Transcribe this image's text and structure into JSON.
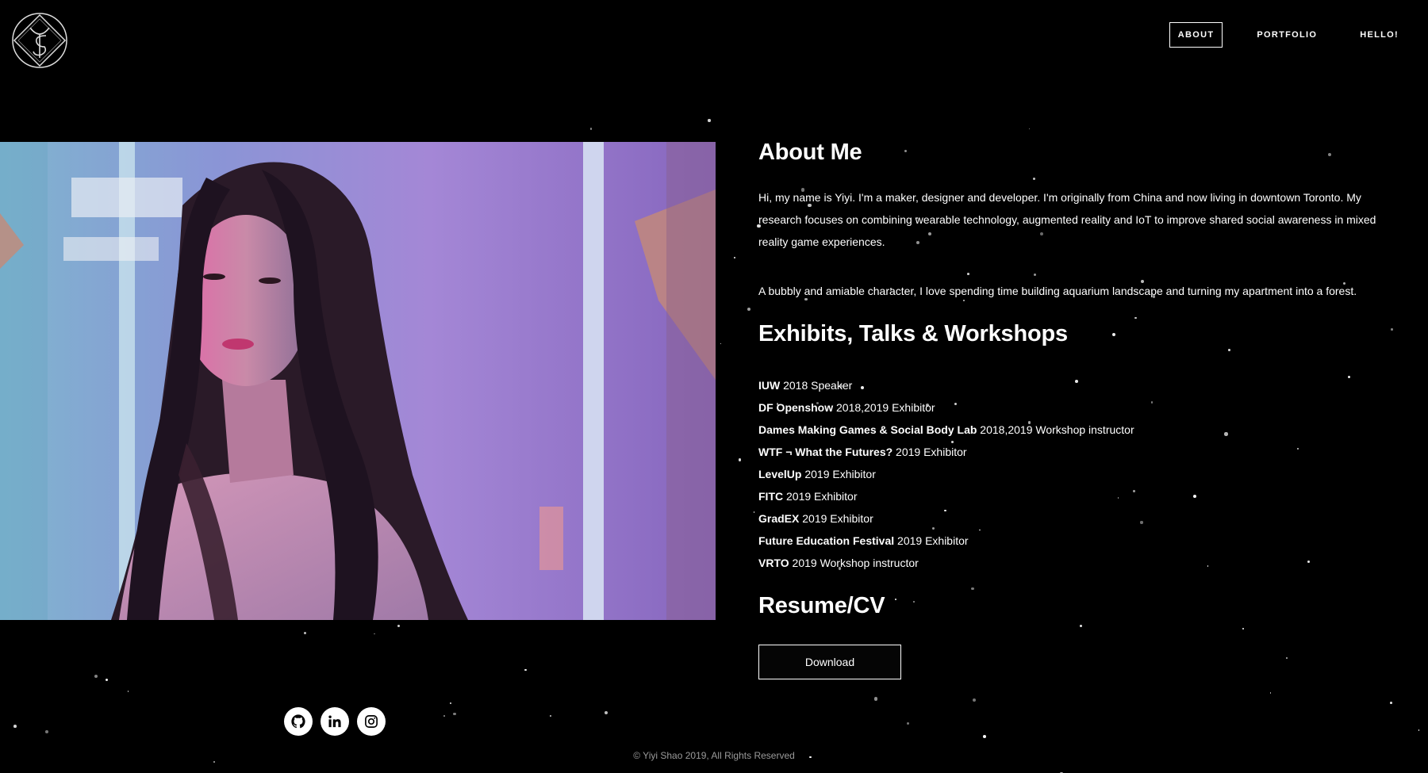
{
  "nav": {
    "items": [
      {
        "label": "ABOUT",
        "active": true
      },
      {
        "label": "PORTFOLIO",
        "active": false
      },
      {
        "label": "HELLO!",
        "active": false
      }
    ]
  },
  "about": {
    "title": "About Me",
    "paragraph1": "Hi, my name is Yiyi. I'm a maker, designer and developer. I'm originally from China and now living in downtown Toronto. My research focuses on combining wearable technology, augmented reality and IoT to improve shared social awareness in mixed reality game experiences.",
    "paragraph2": "A bubbly and amiable character, I love spending time building aquarium landscape and turning my apartment into a forest."
  },
  "exhibits": {
    "title": "Exhibits, Talks & Workshops",
    "items": [
      {
        "name": "IUW",
        "detail": " 2018 Speaker"
      },
      {
        "name": "DF Openshow",
        "detail": " 2018,2019 Exhibitor"
      },
      {
        "name": "Dames Making Games & Social Body Lab",
        "detail": " 2018,2019 Workshop instructor"
      },
      {
        "name": "WTF ¬ What the Futures?",
        "detail": " 2019 Exhibitor"
      },
      {
        "name": "LevelUp",
        "detail": " 2019 Exhibitor"
      },
      {
        "name": "FITC",
        "detail": " 2019 Exhibitor"
      },
      {
        "name": "GradEX",
        "detail": " 2019 Exhibitor"
      },
      {
        "name": "Future Education Festival",
        "detail": " 2019 Exhibitor"
      },
      {
        "name": "VRTO",
        "detail": " 2019 Workshop instructor"
      }
    ]
  },
  "resume": {
    "title": "Resume/CV",
    "download_label": "Download"
  },
  "social": [
    "github-icon",
    "linkedin-icon",
    "instagram-icon"
  ],
  "footer": {
    "copyright": "© Yiyi Shao 2019, All Rights Reserved"
  },
  "colors": {
    "background": "#000000",
    "text": "#ffffff",
    "muted": "#9a9a9a"
  }
}
